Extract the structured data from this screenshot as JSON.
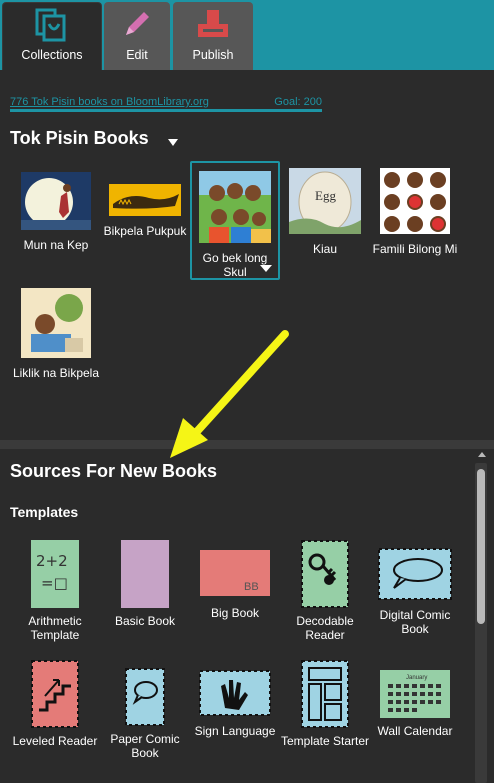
{
  "tabs": [
    {
      "label": "Collections",
      "icon": "collections-icon",
      "active": true
    },
    {
      "label": "Edit",
      "icon": "pencil-icon",
      "active": false
    },
    {
      "label": "Publish",
      "icon": "publish-icon",
      "active": false
    }
  ],
  "library": {
    "count_text": "776 Tok Pisin books on BloomLibrary.org",
    "goal_text": "Goal: 200"
  },
  "collection": {
    "title": "Tok Pisin Books",
    "books": [
      {
        "title": "Mun na Kep"
      },
      {
        "title": "Bikpela Pukpuk"
      },
      {
        "title": "Go bek long Skul"
      },
      {
        "title": "Kiau"
      },
      {
        "title": "Famili Bilong Mi"
      },
      {
        "title": "Liklik na Bikpela"
      }
    ]
  },
  "sources": {
    "title": "Sources For New Books",
    "templates_title": "Templates",
    "templates": [
      {
        "label": "Arithmetic Template"
      },
      {
        "label": "Basic Book"
      },
      {
        "label": "Big Book"
      },
      {
        "label": "Decodable Reader"
      },
      {
        "label": "Digital Comic Book"
      },
      {
        "label": "Leveled Reader"
      },
      {
        "label": "Paper Comic Book"
      },
      {
        "label": "Sign Language"
      },
      {
        "label": "Template Starter"
      },
      {
        "label": "Wall Calendar"
      }
    ],
    "arithmetic_text": "2+2\n=□",
    "bigbook_text": "BB",
    "calendar_month": "January"
  },
  "book_thumbs": {
    "kiau_text": "Egg"
  },
  "colors": {
    "accent": "#1d94a4",
    "panel": "#2b2b2b",
    "tab_inactive": "#575757",
    "arrow": "#f5f516"
  }
}
